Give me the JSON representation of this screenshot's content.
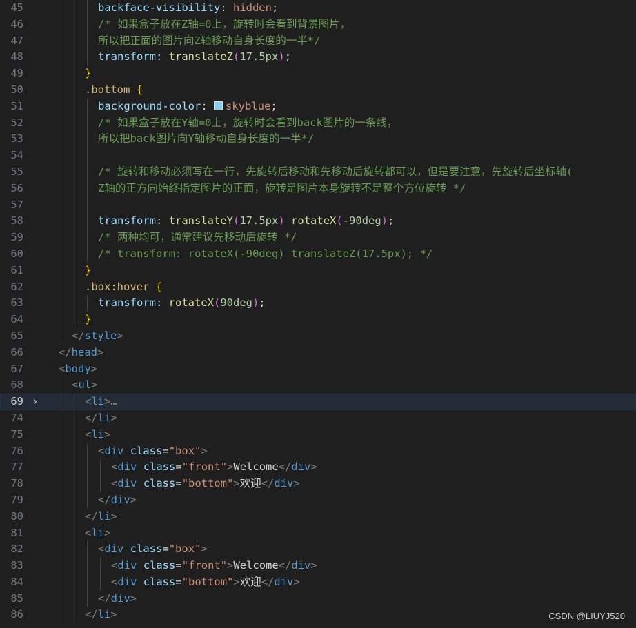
{
  "theme": {
    "colors": {
      "prop": "#9cdcfe",
      "value": "#ce9178",
      "plain": "#d4d4d4",
      "comment": "#6a9955",
      "selector": "#d7ba7d",
      "func": "#dcdcaa",
      "number": "#b5cea8",
      "bracket1": "#ffd700",
      "bracket2": "#da70d6",
      "tag": "#569cd6",
      "tagBracket": "#808080",
      "attr": "#9cdcfe",
      "fold": "#cccccc",
      "swatch": "#87ceeb"
    }
  },
  "editor": {
    "current_line": "69",
    "lines": [
      {
        "n": "45",
        "indent": 3,
        "tokens": [
          [
            "prop",
            "backface-visibility"
          ],
          [
            "plain",
            ": "
          ],
          [
            "value",
            "hidden"
          ],
          [
            "plain",
            ";"
          ]
        ]
      },
      {
        "n": "46",
        "indent": 3,
        "tokens": [
          [
            "comment",
            "/* 如果盒子放在Z轴=0上，旋转时会看到背景图片，"
          ]
        ]
      },
      {
        "n": "47",
        "indent": 3,
        "tokens": [
          [
            "comment",
            "所以把正面的图片向Z轴移动自身长度的一半*/"
          ]
        ]
      },
      {
        "n": "48",
        "indent": 3,
        "tokens": [
          [
            "prop",
            "transform"
          ],
          [
            "plain",
            ": "
          ],
          [
            "func",
            "translateZ"
          ],
          [
            "bracket2",
            "("
          ],
          [
            "number",
            "17.5px"
          ],
          [
            "bracket2",
            ")"
          ],
          [
            "plain",
            ";"
          ]
        ]
      },
      {
        "n": "49",
        "indent": 2,
        "tokens": [
          [
            "bracket1",
            "}"
          ]
        ]
      },
      {
        "n": "50",
        "indent": 2,
        "tokens": [
          [
            "selector",
            ".bottom"
          ],
          [
            "plain",
            " "
          ],
          [
            "bracket1",
            "{"
          ]
        ]
      },
      {
        "n": "51",
        "indent": 3,
        "tokens": [
          [
            "prop",
            "background-color"
          ],
          [
            "plain",
            ": "
          ],
          [
            "swatch",
            ""
          ],
          [
            "value",
            "skyblue"
          ],
          [
            "plain",
            ";"
          ]
        ]
      },
      {
        "n": "52",
        "indent": 3,
        "tokens": [
          [
            "comment",
            "/* 如果盒子放在Y轴=0上，旋转时会看到back图片的一条线，"
          ]
        ]
      },
      {
        "n": "53",
        "indent": 3,
        "tokens": [
          [
            "comment",
            "所以把back图片向Y轴移动自身长度的一半*/"
          ]
        ]
      },
      {
        "n": "54",
        "indent": 3,
        "tokens": []
      },
      {
        "n": "55",
        "indent": 3,
        "tokens": [
          [
            "comment",
            "/* 旋转和移动必须写在一行，先旋转后移动和先移动后旋转都可以，但是要注意，先旋转后坐标轴("
          ]
        ]
      },
      {
        "n": "56",
        "indent": 3,
        "tokens": [
          [
            "comment",
            "Z轴的正方向始终指定图片的正面，旋转是图片本身旋转不是整个方位旋转 */"
          ]
        ]
      },
      {
        "n": "57",
        "indent": 3,
        "tokens": []
      },
      {
        "n": "58",
        "indent": 3,
        "tokens": [
          [
            "prop",
            "transform"
          ],
          [
            "plain",
            ": "
          ],
          [
            "func",
            "translateY"
          ],
          [
            "bracket2",
            "("
          ],
          [
            "number",
            "17.5px"
          ],
          [
            "bracket2",
            ")"
          ],
          [
            "plain",
            " "
          ],
          [
            "func",
            "rotateX"
          ],
          [
            "bracket2",
            "("
          ],
          [
            "number",
            "-90deg"
          ],
          [
            "bracket2",
            ")"
          ],
          [
            "plain",
            ";"
          ]
        ]
      },
      {
        "n": "59",
        "indent": 3,
        "tokens": [
          [
            "comment",
            "/* 两种均可，通常建议先移动后旋转 */"
          ]
        ]
      },
      {
        "n": "60",
        "indent": 3,
        "tokens": [
          [
            "comment",
            "/* transform: rotateX(-90deg) translateZ(17.5px); */"
          ]
        ]
      },
      {
        "n": "61",
        "indent": 2,
        "tokens": [
          [
            "bracket1",
            "}"
          ]
        ]
      },
      {
        "n": "62",
        "indent": 2,
        "tokens": [
          [
            "selector",
            ".box:hover"
          ],
          [
            "plain",
            " "
          ],
          [
            "bracket1",
            "{"
          ]
        ]
      },
      {
        "n": "63",
        "indent": 3,
        "tokens": [
          [
            "prop",
            "transform"
          ],
          [
            "plain",
            ": "
          ],
          [
            "func",
            "rotateX"
          ],
          [
            "bracket2",
            "("
          ],
          [
            "number",
            "90deg"
          ],
          [
            "bracket2",
            ")"
          ],
          [
            "plain",
            ";"
          ]
        ]
      },
      {
        "n": "64",
        "indent": 2,
        "tokens": [
          [
            "bracket1",
            "}"
          ]
        ]
      },
      {
        "n": "65",
        "indent": 1,
        "tokens": [
          [
            "tagBracket",
            "</"
          ],
          [
            "tag",
            "style"
          ],
          [
            "tagBracket",
            ">"
          ]
        ]
      },
      {
        "n": "66",
        "indent": 0,
        "tokens": [
          [
            "tagBracket",
            "</"
          ],
          [
            "tag",
            "head"
          ],
          [
            "tagBracket",
            ">"
          ]
        ]
      },
      {
        "n": "67",
        "indent": 0,
        "tokens": [
          [
            "tagBracket",
            "<"
          ],
          [
            "tag",
            "body"
          ],
          [
            "tagBracket",
            ">"
          ]
        ]
      },
      {
        "n": "68",
        "indent": 1,
        "tokens": [
          [
            "tagBracket",
            "<"
          ],
          [
            "tag",
            "ul"
          ],
          [
            "tagBracket",
            ">"
          ]
        ]
      },
      {
        "n": "69",
        "indent": 2,
        "fold": "›",
        "tokens": [
          [
            "tagBracket",
            "<"
          ],
          [
            "tag",
            "li"
          ],
          [
            "tagBracket",
            ">"
          ],
          [
            "tagBracket",
            "…"
          ]
        ]
      },
      {
        "n": "74",
        "indent": 2,
        "tokens": [
          [
            "tagBracket",
            "</"
          ],
          [
            "tag",
            "li"
          ],
          [
            "tagBracket",
            ">"
          ]
        ]
      },
      {
        "n": "75",
        "indent": 2,
        "tokens": [
          [
            "tagBracket",
            "<"
          ],
          [
            "tag",
            "li"
          ],
          [
            "tagBracket",
            ">"
          ]
        ]
      },
      {
        "n": "76",
        "indent": 3,
        "tokens": [
          [
            "tagBracket",
            "<"
          ],
          [
            "tag",
            "div"
          ],
          [
            "plain",
            " "
          ],
          [
            "attr",
            "class"
          ],
          [
            "plain",
            "="
          ],
          [
            "value",
            "\"box\""
          ],
          [
            "tagBracket",
            ">"
          ]
        ]
      },
      {
        "n": "77",
        "indent": 4,
        "tokens": [
          [
            "tagBracket",
            "<"
          ],
          [
            "tag",
            "div"
          ],
          [
            "plain",
            " "
          ],
          [
            "attr",
            "class"
          ],
          [
            "plain",
            "="
          ],
          [
            "value",
            "\"front\""
          ],
          [
            "tagBracket",
            ">"
          ],
          [
            "plain",
            "Welcome"
          ],
          [
            "tagBracket",
            "</"
          ],
          [
            "tag",
            "div"
          ],
          [
            "tagBracket",
            ">"
          ]
        ]
      },
      {
        "n": "78",
        "indent": 4,
        "tokens": [
          [
            "tagBracket",
            "<"
          ],
          [
            "tag",
            "div"
          ],
          [
            "plain",
            " "
          ],
          [
            "attr",
            "class"
          ],
          [
            "plain",
            "="
          ],
          [
            "value",
            "\"bottom\""
          ],
          [
            "tagBracket",
            ">"
          ],
          [
            "plain",
            "欢迎"
          ],
          [
            "tagBracket",
            "</"
          ],
          [
            "tag",
            "div"
          ],
          [
            "tagBracket",
            ">"
          ]
        ]
      },
      {
        "n": "79",
        "indent": 3,
        "tokens": [
          [
            "tagBracket",
            "</"
          ],
          [
            "tag",
            "div"
          ],
          [
            "tagBracket",
            ">"
          ]
        ]
      },
      {
        "n": "80",
        "indent": 2,
        "tokens": [
          [
            "tagBracket",
            "</"
          ],
          [
            "tag",
            "li"
          ],
          [
            "tagBracket",
            ">"
          ]
        ]
      },
      {
        "n": "81",
        "indent": 2,
        "tokens": [
          [
            "tagBracket",
            "<"
          ],
          [
            "tag",
            "li"
          ],
          [
            "tagBracket",
            ">"
          ]
        ]
      },
      {
        "n": "82",
        "indent": 3,
        "tokens": [
          [
            "tagBracket",
            "<"
          ],
          [
            "tag",
            "div"
          ],
          [
            "plain",
            " "
          ],
          [
            "attr",
            "class"
          ],
          [
            "plain",
            "="
          ],
          [
            "value",
            "\"box\""
          ],
          [
            "tagBracket",
            ">"
          ]
        ]
      },
      {
        "n": "83",
        "indent": 4,
        "tokens": [
          [
            "tagBracket",
            "<"
          ],
          [
            "tag",
            "div"
          ],
          [
            "plain",
            " "
          ],
          [
            "attr",
            "class"
          ],
          [
            "plain",
            "="
          ],
          [
            "value",
            "\"front\""
          ],
          [
            "tagBracket",
            ">"
          ],
          [
            "plain",
            "Welcome"
          ],
          [
            "tagBracket",
            "</"
          ],
          [
            "tag",
            "div"
          ],
          [
            "tagBracket",
            ">"
          ]
        ]
      },
      {
        "n": "84",
        "indent": 4,
        "tokens": [
          [
            "tagBracket",
            "<"
          ],
          [
            "tag",
            "div"
          ],
          [
            "plain",
            " "
          ],
          [
            "attr",
            "class"
          ],
          [
            "plain",
            "="
          ],
          [
            "value",
            "\"bottom\""
          ],
          [
            "tagBracket",
            ">"
          ],
          [
            "plain",
            "欢迎"
          ],
          [
            "tagBracket",
            "</"
          ],
          [
            "tag",
            "div"
          ],
          [
            "tagBracket",
            ">"
          ]
        ]
      },
      {
        "n": "85",
        "indent": 3,
        "tokens": [
          [
            "tagBracket",
            "</"
          ],
          [
            "tag",
            "div"
          ],
          [
            "tagBracket",
            ">"
          ]
        ]
      },
      {
        "n": "86",
        "indent": 2,
        "tokens": [
          [
            "tagBracket",
            "</"
          ],
          [
            "tag",
            "li"
          ],
          [
            "tagBracket",
            ">"
          ]
        ]
      }
    ]
  },
  "watermark": "CSDN @LIUYJ520"
}
